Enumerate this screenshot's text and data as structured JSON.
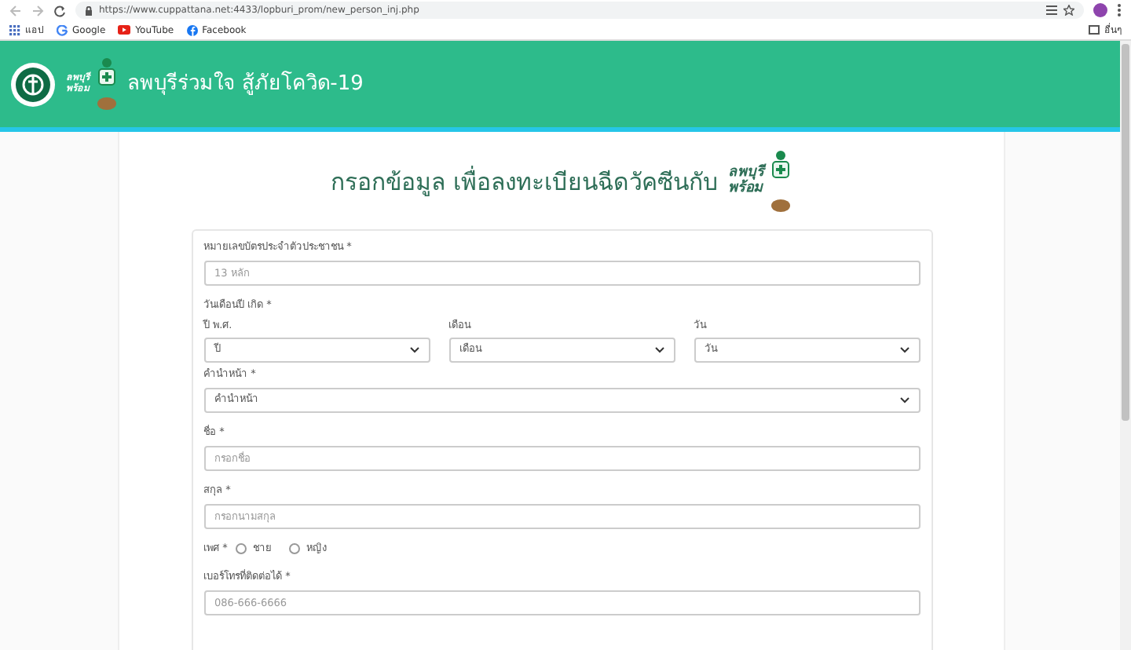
{
  "browser": {
    "url": "https://www.cuppattana.net:4433/lopburi_prom/new_person_inj.php",
    "bookmarks": [
      {
        "kind": "apps",
        "label": "แอป"
      },
      {
        "kind": "google",
        "label": "Google"
      },
      {
        "kind": "youtube",
        "label": "YouTube"
      },
      {
        "kind": "facebook",
        "label": "Facebook"
      }
    ],
    "other_bookmarks": "อื่นๆ"
  },
  "header": {
    "title": "ลพบุรีร่วมใจ สู้ภัยโควิด-19",
    "logo_text": [
      "ลพบุรี",
      "พร้อม"
    ]
  },
  "heading": {
    "text": "กรอกข้อมูล เพื่อลงทะเบียนฉีดวัคซีนกับ",
    "logo_text": [
      "ลพบุรี",
      "พร้อม"
    ]
  },
  "form": {
    "fields": [
      {
        "kind": "text",
        "label": "หมายเลขบัตรประจำตัวประชาชน *",
        "placeholder": "13 หลัก"
      },
      {
        "kind": "date",
        "label": "วันเดือนปี เกิด *",
        "parts": [
          {
            "label": "ปี พ.ศ.",
            "value": "ปี"
          },
          {
            "label": "เดือน",
            "value": "เดือน"
          },
          {
            "label": "วัน",
            "value": "วัน"
          }
        ]
      },
      {
        "kind": "select",
        "label": "คำนำหน้า *",
        "value": "คำนำหน้า"
      },
      {
        "kind": "text",
        "label": "ชื่อ *",
        "placeholder": "กรอกชื่อ"
      },
      {
        "kind": "text",
        "label": "สกุล *",
        "placeholder": "กรอกนามสกุล"
      },
      {
        "kind": "radio",
        "label": "เพศ *",
        "options": [
          {
            "label": "ชาย",
            "selected": false
          },
          {
            "label": "หญิง",
            "selected": false
          }
        ]
      },
      {
        "kind": "text",
        "label": "เบอร์โทรที่ติดต่อได้ *",
        "placeholder": "086-666-6666"
      }
    ]
  }
}
